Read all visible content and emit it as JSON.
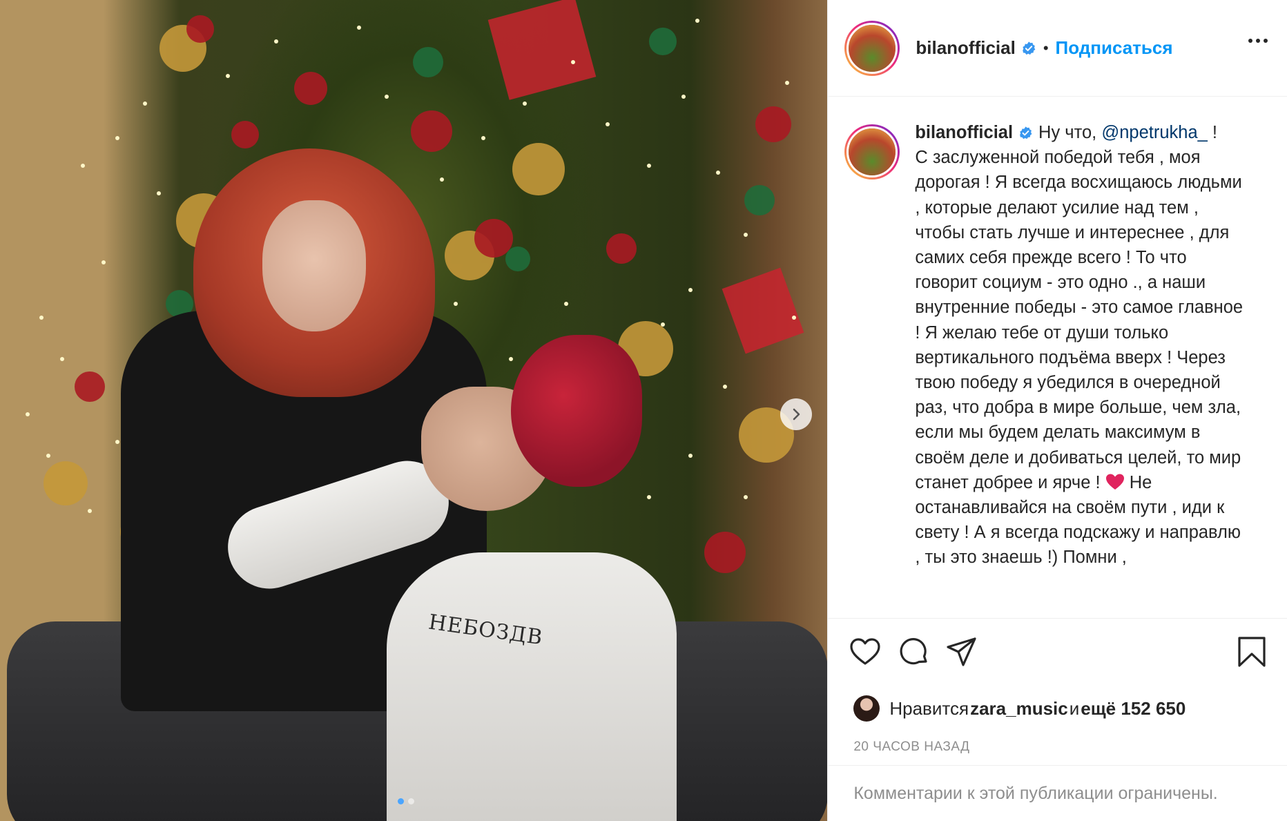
{
  "header": {
    "username": "bilanofficial",
    "separator": "•",
    "follow_label": "Подписаться"
  },
  "caption": {
    "username": "bilanofficial",
    "prefix": "Ну что, ",
    "mention": "@npetrukha_",
    "after_mention": " !",
    "body_before_heart": "С заслуженной победой тебя , моя дорогая ! Я всегда восхищаюсь людьми , которые делают усилие над тем , чтобы стать лучше и интереснее , для самих себя прежде всего ! То что говорит социум - это одно ., а наши внутренние победы - это самое главное ! Я желаю тебе от души только вертикального подъёма вверх ! Через твою победу я убедился в очередной раз, что добра в мире больше, чем зла, если мы будем делать максимум в своём деле и добиваться целей, то мир станет добрее и ярче ! ",
    "body_after_heart": " Не останавливайся на своём пути , иди к свету ! А я всегда подскажу и направлю , ты это знаешь !) Помни ,"
  },
  "likes": {
    "prefix": "Нравится ",
    "user": "zara_music",
    "middle": " и ",
    "count": "ещё 152 650"
  },
  "timestamp": "20 ЧАСОВ НАЗАД",
  "comments_restricted": "Комментарии к этой публикации ограничены.",
  "photo_shirt_print": "НЕБОЗДВ",
  "carousel": {
    "total": 2,
    "current": 1
  },
  "colors": {
    "link": "#0095f6",
    "mention": "#00376b",
    "verified": "#3897f0",
    "muted": "#8e8e8e",
    "heart": "#e0245e"
  },
  "icons": [
    "verified-badge-icon",
    "more-options-icon",
    "heart-icon",
    "comment-icon",
    "share-icon",
    "bookmark-icon",
    "chevron-right-icon"
  ]
}
